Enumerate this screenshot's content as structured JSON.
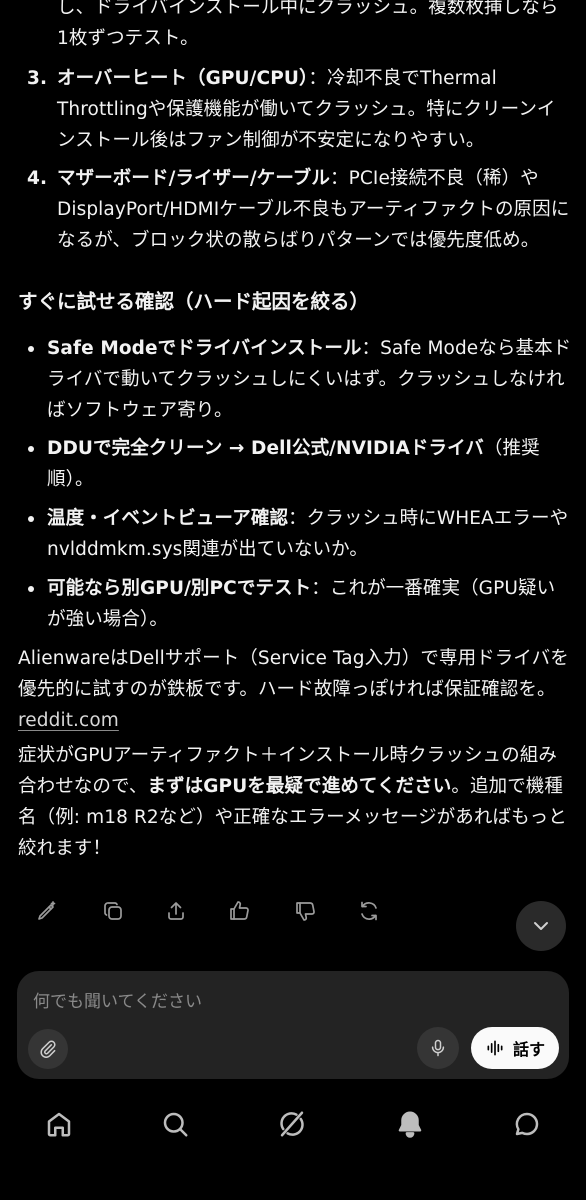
{
  "answer": {
    "list_top_partial": "し、ドライバインストール中にクラッシュ。複数枚挿しなら1枚ずつテスト。",
    "list_top_partial_line1": "し、ドライバインストール中にクラッシュ。複数枚挿しなら",
    "list_top_partial_line2": "1枚ずつテスト。",
    "numbered": [
      {
        "num": "3.",
        "bold": "オーバーヒート（GPU/CPU）",
        "text": "：冷却不良でThermal Throttlingや保護機能が働いてクラッシュ。特にクリーンインストール後はファン制御が不安定になりやすい。"
      },
      {
        "num": "4.",
        "bold": "マザーボード/ライザー/ケーブル",
        "text": "：PCIe接続不良（稀）やDisplayPort/HDMIケーブル不良もアーティファクトの原因になるが、ブロック状の散らばりパターンでは優先度低め。"
      }
    ],
    "section_heading": "すぐに試せる確認（ハード起因を絞る）",
    "bullets": [
      {
        "bold": "Safe Modeでドライバインストール",
        "text": "：Safe Modeなら基本ドライバで動いてクラッシュしにくいはず。クラッシュしなければソフトウェア寄り。"
      },
      {
        "bold": "DDUで完全クリーン → Dell公式/NVIDIAドライバ",
        "text": "（推奨順）。"
      },
      {
        "bold": "温度・イベントビューア確認",
        "text": "：クラッシュ時にWHEAエラーやnvlddmkm.sys関連が出ていないか。"
      },
      {
        "bold": "可能なら別GPU/別PCでテスト",
        "text": "：これが一番確実（GPU疑いが強い場合）。"
      }
    ],
    "para1": "AlienwareはDellサポート（Service Tag入力）で専用ドライバを優先的に試すのが鉄板です。ハード故障っぽければ保証確認を。",
    "para1_link": "reddit.com",
    "para2_a": "症状がGPUアーティファクト＋インストール時クラッシュの組み合わせなので、",
    "para2_bold": "まずはGPUを最疑で進めてください",
    "para2_b": "。追加で機種名（例: m18 R2など）や正確なエラーメッセージがあればもっと絞れます！"
  },
  "actions": [
    "edit-icon",
    "copy-icon",
    "share-icon",
    "thumbs-up-icon",
    "thumbs-down-icon",
    "regenerate-icon"
  ],
  "composer": {
    "placeholder": "何でも聞いてください",
    "talk_label": "話す"
  },
  "nav": [
    "home-icon",
    "search-icon",
    "grok-logo-icon",
    "notifications-icon",
    "messages-icon"
  ]
}
